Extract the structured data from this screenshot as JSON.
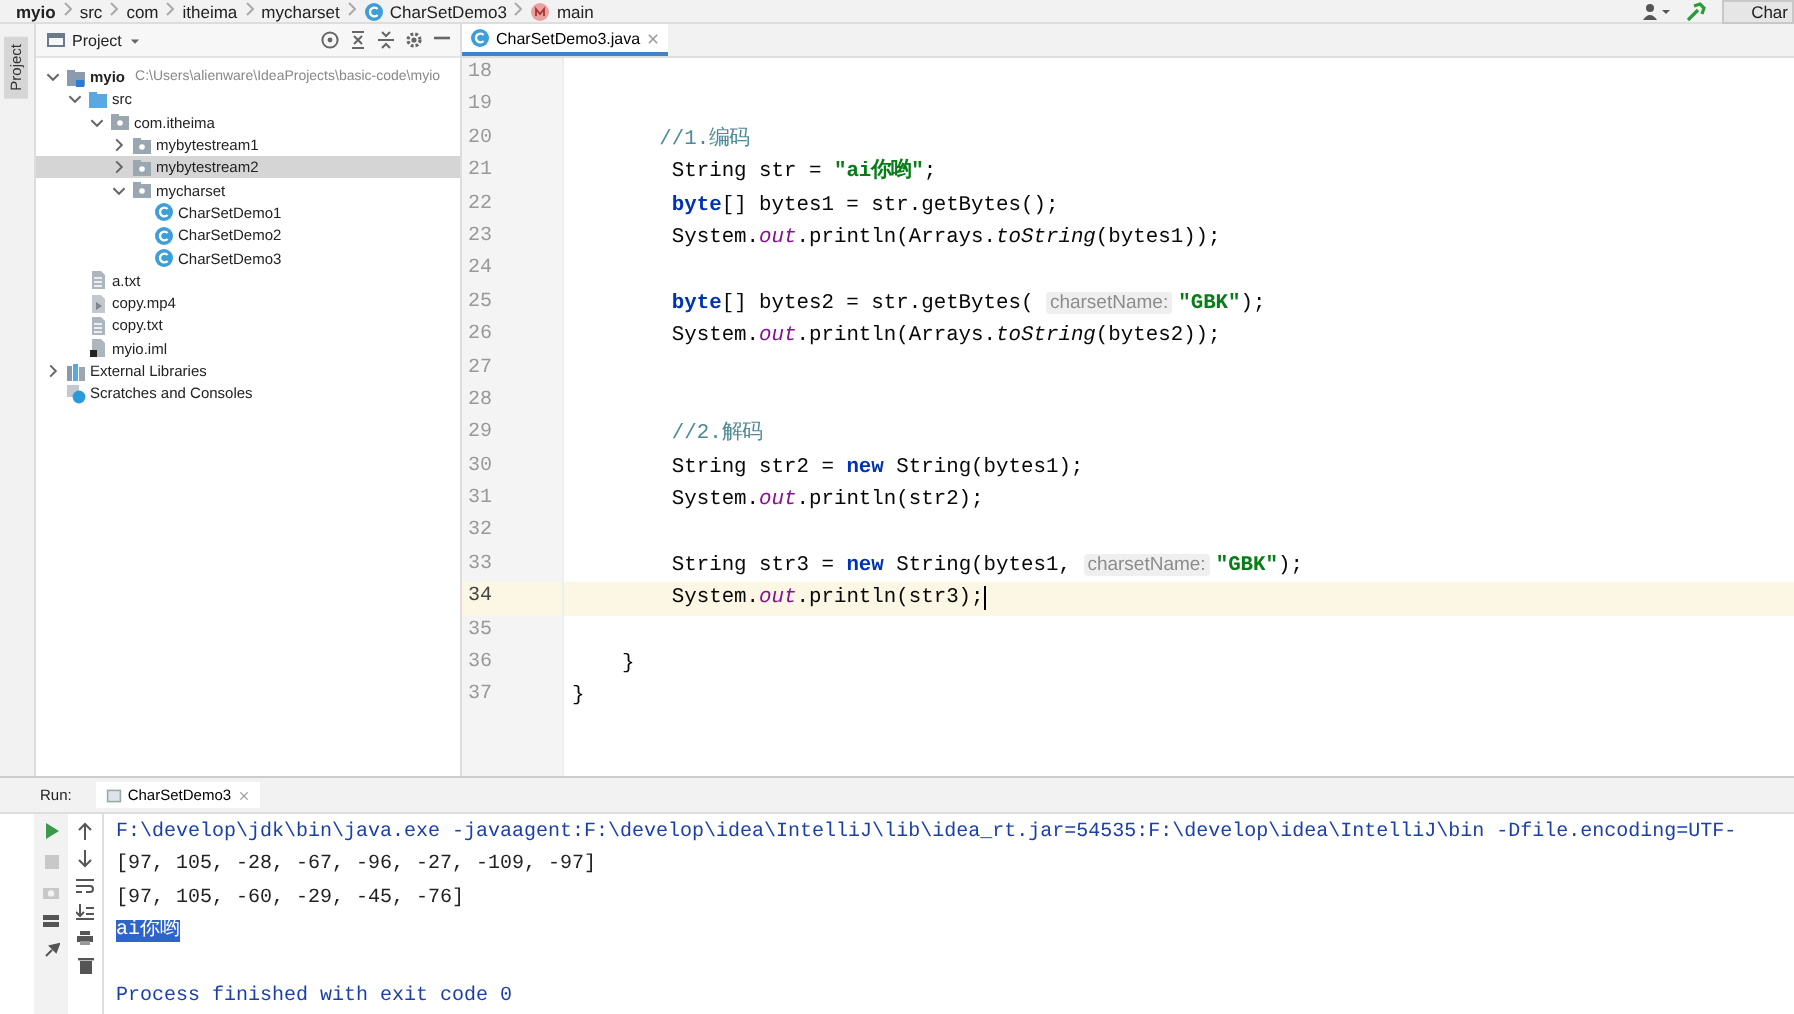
{
  "breadcrumb": [
    {
      "label": "myio",
      "kind": "module"
    },
    {
      "label": "src",
      "kind": "plain"
    },
    {
      "label": "com",
      "kind": "plain"
    },
    {
      "label": "itheima",
      "kind": "plain"
    },
    {
      "label": "mycharset",
      "kind": "plain"
    },
    {
      "label": "CharSetDemo3",
      "kind": "class"
    },
    {
      "label": "main",
      "kind": "method"
    }
  ],
  "top_right": {
    "run_config_label": "Char"
  },
  "side_stripe": {
    "label": "Project",
    "selected": true
  },
  "project_panel": {
    "title": "Project",
    "tree": [
      {
        "label": "myio",
        "location": "C:\\Users\\alienware\\IdeaProjects\\basic-code\\myio",
        "kind": "module",
        "expanded": true,
        "selected": false,
        "children": [
          {
            "label": "src",
            "kind": "source",
            "expanded": true,
            "selected": false,
            "children": [
              {
                "label": "com.itheima",
                "kind": "package",
                "expanded": true,
                "selected": false,
                "children": [
                  {
                    "label": "mybytestream1",
                    "kind": "package",
                    "expanded": false,
                    "selected": false
                  },
                  {
                    "label": "mybytestream2",
                    "kind": "package",
                    "expanded": false,
                    "selected": true
                  },
                  {
                    "label": "mycharset",
                    "kind": "package",
                    "expanded": true,
                    "selected": false,
                    "children": [
                      {
                        "label": "CharSetDemo1",
                        "kind": "class",
                        "selected": false
                      },
                      {
                        "label": "CharSetDemo2",
                        "kind": "class",
                        "selected": false
                      },
                      {
                        "label": "CharSetDemo3",
                        "kind": "class",
                        "selected": false
                      }
                    ]
                  }
                ]
              }
            ]
          },
          {
            "label": "a.txt",
            "kind": "text",
            "selected": false
          },
          {
            "label": "copy.mp4",
            "kind": "media",
            "selected": false
          },
          {
            "label": "copy.txt",
            "kind": "text",
            "selected": false
          },
          {
            "label": "myio.iml",
            "kind": "iml",
            "selected": false
          }
        ]
      },
      {
        "label": "External Libraries",
        "kind": "library",
        "expanded": false,
        "selected": false
      },
      {
        "label": "Scratches and Consoles",
        "kind": "scratches",
        "selected": false
      }
    ]
  },
  "editor": {
    "tabs": [
      {
        "label": "CharSetDemo3.java",
        "selected": true
      }
    ],
    "lines": [
      {
        "number": "18",
        "current": false
      },
      {
        "number": "19",
        "current": false
      },
      {
        "number": "20",
        "current": false,
        "tokens": [
          {
            "kind": "comment",
            "text": "       //1.编码"
          }
        ]
      },
      {
        "number": "21",
        "current": false,
        "tokens": [
          {
            "kind": "plain",
            "text": "        String str = "
          },
          {
            "kind": "string",
            "text": "\"ai你哟\""
          },
          {
            "kind": "plain",
            "text": ";"
          }
        ]
      },
      {
        "number": "22",
        "current": false,
        "tokens": [
          {
            "kind": "keyword",
            "text": "        byte"
          },
          {
            "kind": "plain",
            "text": "[] bytes1 = str.getBytes();"
          }
        ]
      },
      {
        "number": "23",
        "current": false,
        "tokens": [
          {
            "kind": "plain",
            "text": "        System."
          },
          {
            "kind": "field",
            "text": "out"
          },
          {
            "kind": "plain",
            "text": ".println(Arrays."
          },
          {
            "kind": "static",
            "text": "toString"
          },
          {
            "kind": "plain",
            "text": "(bytes1));"
          }
        ]
      },
      {
        "number": "24",
        "current": false
      },
      {
        "number": "25",
        "current": false,
        "tokens": [
          {
            "kind": "keyword",
            "text": "        byte"
          },
          {
            "kind": "plain",
            "text": "[] bytes2 = str.getBytes( "
          },
          {
            "kind": "hint",
            "text": "charsetName:"
          },
          {
            "kind": "string",
            "text": "\"GBK\""
          },
          {
            "kind": "plain",
            "text": ");"
          }
        ]
      },
      {
        "number": "26",
        "current": false,
        "tokens": [
          {
            "kind": "plain",
            "text": "        System."
          },
          {
            "kind": "field",
            "text": "out"
          },
          {
            "kind": "plain",
            "text": ".println(Arrays."
          },
          {
            "kind": "static",
            "text": "toString"
          },
          {
            "kind": "plain",
            "text": "(bytes2));"
          }
        ]
      },
      {
        "number": "27",
        "current": false
      },
      {
        "number": "28",
        "current": false
      },
      {
        "number": "29",
        "current": false,
        "tokens": [
          {
            "kind": "comment",
            "text": "        //2.解码"
          }
        ]
      },
      {
        "number": "30",
        "current": false,
        "tokens": [
          {
            "kind": "plain",
            "text": "        String str2 = "
          },
          {
            "kind": "keyword",
            "text": "new"
          },
          {
            "kind": "plain",
            "text": " String(bytes1);"
          }
        ]
      },
      {
        "number": "31",
        "current": false,
        "tokens": [
          {
            "kind": "plain",
            "text": "        System."
          },
          {
            "kind": "field",
            "text": "out"
          },
          {
            "kind": "plain",
            "text": ".println(str2);"
          }
        ]
      },
      {
        "number": "32",
        "current": false
      },
      {
        "number": "33",
        "current": false,
        "tokens": [
          {
            "kind": "plain",
            "text": "        String str3 = "
          },
          {
            "kind": "keyword",
            "text": "new"
          },
          {
            "kind": "plain",
            "text": " String(bytes1, "
          },
          {
            "kind": "hint",
            "text": "charsetName:"
          },
          {
            "kind": "string",
            "text": "\"GBK\""
          },
          {
            "kind": "plain",
            "text": ");"
          }
        ]
      },
      {
        "number": "34",
        "current": true,
        "tokens": [
          {
            "kind": "plain",
            "text": "        System."
          },
          {
            "kind": "field",
            "text": "out"
          },
          {
            "kind": "plain",
            "text": ".println(str3);"
          }
        ]
      },
      {
        "number": "35",
        "current": false
      },
      {
        "number": "36",
        "current": false,
        "tokens": [
          {
            "kind": "plain",
            "text": "    }"
          }
        ]
      },
      {
        "number": "37",
        "current": false,
        "tokens": [
          {
            "kind": "plain",
            "text": "}"
          }
        ]
      }
    ]
  },
  "run_panel": {
    "title": "Run:",
    "tabs": [
      {
        "label": "CharSetDemo3",
        "selected": true
      }
    ],
    "console": [
      {
        "kind": "command",
        "text": "F:\\develop\\jdk\\bin\\java.exe -javaagent:F:\\develop\\idea\\IntelliJ\\lib\\idea_rt.jar=54535:F:\\develop\\idea\\IntelliJ\\bin -Dfile.encoding=UTF-"
      },
      {
        "kind": "output",
        "text": "[97, 105, -28, -67, -96, -27, -109, -97]"
      },
      {
        "kind": "output",
        "text": "[97, 105, -60, -29, -45, -76]"
      },
      {
        "kind": "selected",
        "text": "ai你哟"
      },
      {
        "kind": "blank"
      },
      {
        "kind": "status",
        "text": "Process finished with exit code 0"
      }
    ]
  }
}
